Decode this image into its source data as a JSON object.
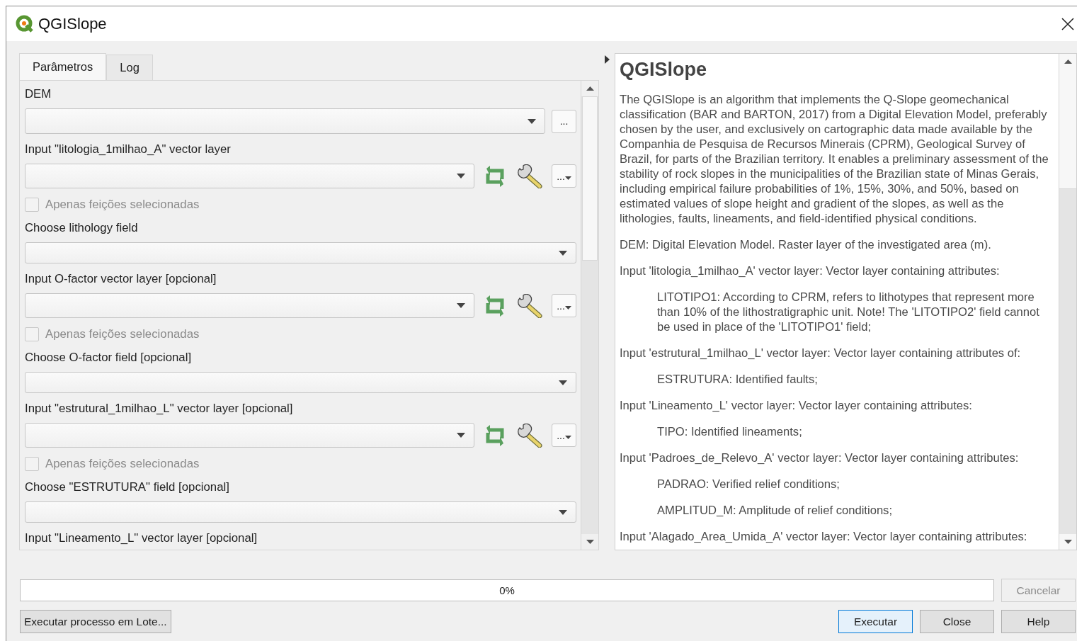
{
  "window": {
    "title": "QGISlope"
  },
  "tabs": [
    {
      "label": "Parâmetros",
      "selected": true
    },
    {
      "label": "Log",
      "selected": false
    }
  ],
  "parameters": [
    {
      "kind": "label",
      "text": "DEM"
    },
    {
      "kind": "raster",
      "button": "..."
    },
    {
      "kind": "label",
      "text": "Input \"litologia_1milhao_A\" vector layer"
    },
    {
      "kind": "vector",
      "button": "..."
    },
    {
      "kind": "checkbox",
      "text": "Apenas feições selecionadas",
      "checked": false,
      "disabled": true
    },
    {
      "kind": "label",
      "text": "Choose lithology field"
    },
    {
      "kind": "field"
    },
    {
      "kind": "label",
      "text": "Input O-factor vector layer [opcional]"
    },
    {
      "kind": "vector",
      "button": "..."
    },
    {
      "kind": "checkbox",
      "text": "Apenas feições selecionadas",
      "checked": false,
      "disabled": true
    },
    {
      "kind": "label",
      "text": "Choose O-factor field [opcional]"
    },
    {
      "kind": "field"
    },
    {
      "kind": "label",
      "text": "Input \"estrutural_1milhao_L\" vector layer [opcional]"
    },
    {
      "kind": "vector",
      "button": "..."
    },
    {
      "kind": "checkbox",
      "text": "Apenas feições selecionadas",
      "checked": false,
      "disabled": true
    },
    {
      "kind": "label",
      "text": "Choose \"ESTRUTURA\" field [opcional]"
    },
    {
      "kind": "field"
    },
    {
      "kind": "label",
      "text": "Input \"Lineamento_L\" vector layer [opcional]"
    }
  ],
  "help": {
    "title": "QGISlope",
    "paragraphs": [
      {
        "kind": "body",
        "text": "The QGISlope is an algorithm that implements the Q-Slope geomechanical classification (BAR and BARTON, 2017) from a Digital Elevation Model, preferably chosen by the user, and exclusively on cartographic data made available by the Companhia de Pesquisa de Recursos Minerais (CPRM), Geological Survey of Brazil, for parts of the Brazilian territory. It enables a preliminary assessment of the stability of rock slopes in the municipalities of the Brazilian state of Minas Gerais, including empirical failure probabilities of 1%, 15%, 30%, and 50%, based on estimated values of slope height and gradient of the slopes, as well as the lithologies, faults, lineaments, and field-identified physical conditions."
      },
      {
        "kind": "body",
        "text": "DEM: Digital Elevation Model. Raster layer of the investigated area (m)."
      },
      {
        "kind": "body",
        "text": "Input 'litologia_1milhao_A' vector layer: Vector layer containing attributes:"
      },
      {
        "kind": "indent",
        "text": "LITOTIPO1: According to CPRM, refers to lithotypes that represent more than 10% of the lithostratigraphic unit. Note! The 'LITOTIPO2' field cannot be used in place of the 'LITOTIPO1' field;"
      },
      {
        "kind": "body",
        "text": "Input 'estrutural_1milhao_L' vector layer: Vector layer containing attributes of:"
      },
      {
        "kind": "indent",
        "text": "ESTRUTURA: Identified faults;"
      },
      {
        "kind": "body",
        "text": "Input 'Lineamento_L' vector layer: Vector layer containing attributes:"
      },
      {
        "kind": "indent",
        "text": "TIPO: Identified lineaments;"
      },
      {
        "kind": "body",
        "text": "Input 'Padroes_de_Relevo_A' vector layer: Vector layer containing attributes:"
      },
      {
        "kind": "indent",
        "text": "PADRAO: Verified relief conditions;"
      },
      {
        "kind": "indent",
        "text": "AMPLITUD_M: Amplitude of relief conditions;"
      },
      {
        "kind": "body",
        "text": "Input 'Alagado_Area_Umida_A' vector layer: Vector layer containing attributes:"
      }
    ]
  },
  "progress": {
    "level": 0,
    "text": "0%"
  },
  "cancel_button": {
    "label": "Cancelar",
    "disabled": true
  },
  "batch_button": "Executar processo em Lote...",
  "buttons": [
    {
      "label": "Executar",
      "default": true
    },
    {
      "label": "Close",
      "default": false
    },
    {
      "label": "Help",
      "default": false
    }
  ]
}
